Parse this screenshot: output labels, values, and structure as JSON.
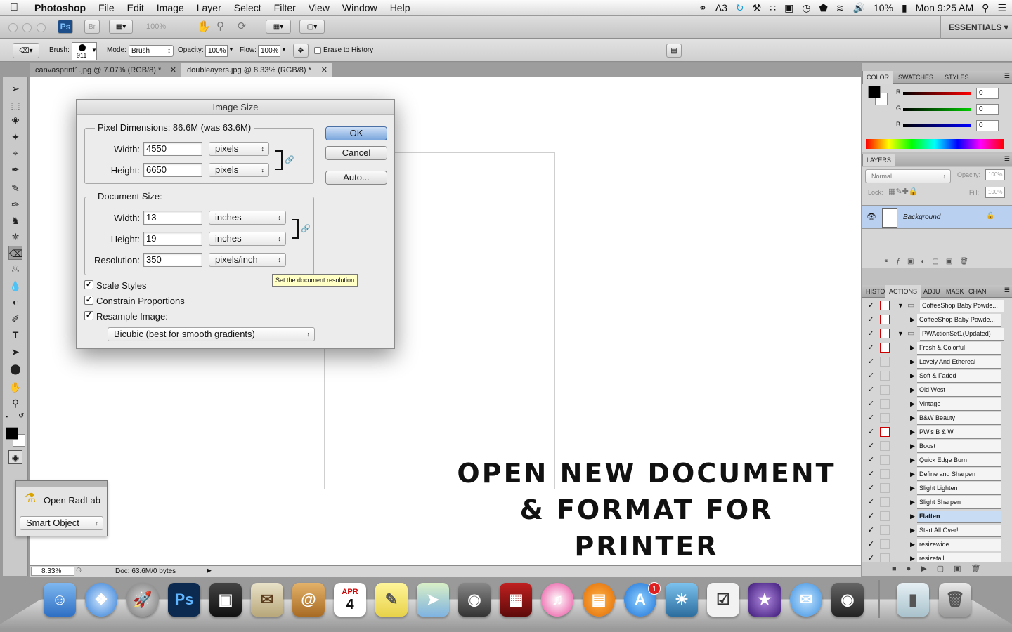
{
  "menubar": {
    "app_name": "Photoshop",
    "items": [
      "File",
      "Edit",
      "Image",
      "Layer",
      "Select",
      "Filter",
      "View",
      "Window",
      "Help"
    ],
    "status": {
      "ai_count": "3",
      "battery": "10%",
      "clock": "Mon 9:25 AM"
    }
  },
  "appbar": {
    "ps_label": "Ps",
    "br_label": "Br",
    "zoom": "100%",
    "workspace": "ESSENTIALS"
  },
  "options": {
    "brush_label": "Brush:",
    "brush_size": "911",
    "mode_label": "Mode:",
    "mode_value": "Brush",
    "opacity_label": "Opacity:",
    "opacity_value": "100%",
    "flow_label": "Flow:",
    "flow_value": "100%",
    "erase_history": "Erase to History"
  },
  "tabs": [
    {
      "label": "canvasprint1.jpg @ 7.07% (RGB/8) *"
    },
    {
      "label": "doubleayers.jpg @ 8.33% (RGB/8) *"
    }
  ],
  "docstatus": {
    "zoom": "8.33%",
    "info": "Doc: 63.6M/0 bytes"
  },
  "dialog": {
    "title": "Image Size",
    "pixel_dims_label": "Pixel Dimensions:  86.6M (was 63.6M)",
    "width_label": "Width:",
    "height_label": "Height:",
    "resolution_label": "Resolution:",
    "px_width": "4550",
    "px_height": "6650",
    "px_unit": "pixels",
    "doc_size_label": "Document Size:",
    "doc_width": "13",
    "doc_height": "19",
    "doc_unit": "inches",
    "resolution": "350",
    "res_unit": "pixels/inch",
    "ok": "OK",
    "cancel": "Cancel",
    "auto": "Auto...",
    "scale_styles": "Scale Styles",
    "constrain": "Constrain Proportions",
    "resample": "Resample Image:",
    "resample_method": "Bicubic (best for smooth gradients)"
  },
  "tooltip": "Set the document resolution",
  "radlab": {
    "open": "Open RadLab",
    "mode": "Smart Object"
  },
  "color_panel": {
    "tabs": [
      "COLOR",
      "SWATCHES",
      "STYLES"
    ],
    "r_label": "R",
    "g_label": "G",
    "b_label": "B",
    "r": "0",
    "g": "0",
    "b": "0"
  },
  "layers_panel": {
    "tab": "LAYERS",
    "blend": "Normal",
    "opacity_label": "Opacity:",
    "opacity": "100%",
    "lock_label": "Lock:",
    "fill_label": "Fill:",
    "fill": "100%",
    "layer_name": "Background"
  },
  "actions_panel": {
    "tabs": [
      "HISTO",
      "ACTIONS",
      "ADJU",
      "MASK",
      "CHAN"
    ],
    "rows": [
      {
        "name": "CoffeeShop Baby Powde...",
        "level": 0,
        "folder": true
      },
      {
        "name": "CoffeeShop Baby Powde...",
        "level": 1,
        "folder": false
      },
      {
        "name": "PWActionSet1(Updated)",
        "level": 0,
        "folder": true
      },
      {
        "name": "Fresh & Colorful",
        "level": 1
      },
      {
        "name": "Lovely And Ethereal",
        "level": 1
      },
      {
        "name": "Soft & Faded",
        "level": 1
      },
      {
        "name": "Old West",
        "level": 1
      },
      {
        "name": "Vintage",
        "level": 1
      },
      {
        "name": "B&W Beauty",
        "level": 1
      },
      {
        "name": "PW's B & W",
        "level": 1
      },
      {
        "name": "Boost",
        "level": 1
      },
      {
        "name": "Quick Edge Burn",
        "level": 1
      },
      {
        "name": "Define and Sharpen",
        "level": 1
      },
      {
        "name": "Slight Lighten",
        "level": 1
      },
      {
        "name": "Slight Sharpen",
        "level": 1
      },
      {
        "name": "Flatten",
        "level": 1,
        "highlight": true
      },
      {
        "name": "Start All Over!",
        "level": 1
      },
      {
        "name": "resizewide",
        "level": 1
      },
      {
        "name": "resizetall",
        "level": 1
      }
    ]
  },
  "overlay": {
    "line1": "OPEN NEW DOCUMENT",
    "line2": "& FORMAT FOR PRINTER"
  },
  "dock": {
    "calendar_month": "APR",
    "calendar_day": "4",
    "appstore_badge": "1"
  },
  "colors": {
    "accent": "#3b7de0",
    "canvas": "#ffffff",
    "ui_gray": "#c9c9c9"
  }
}
